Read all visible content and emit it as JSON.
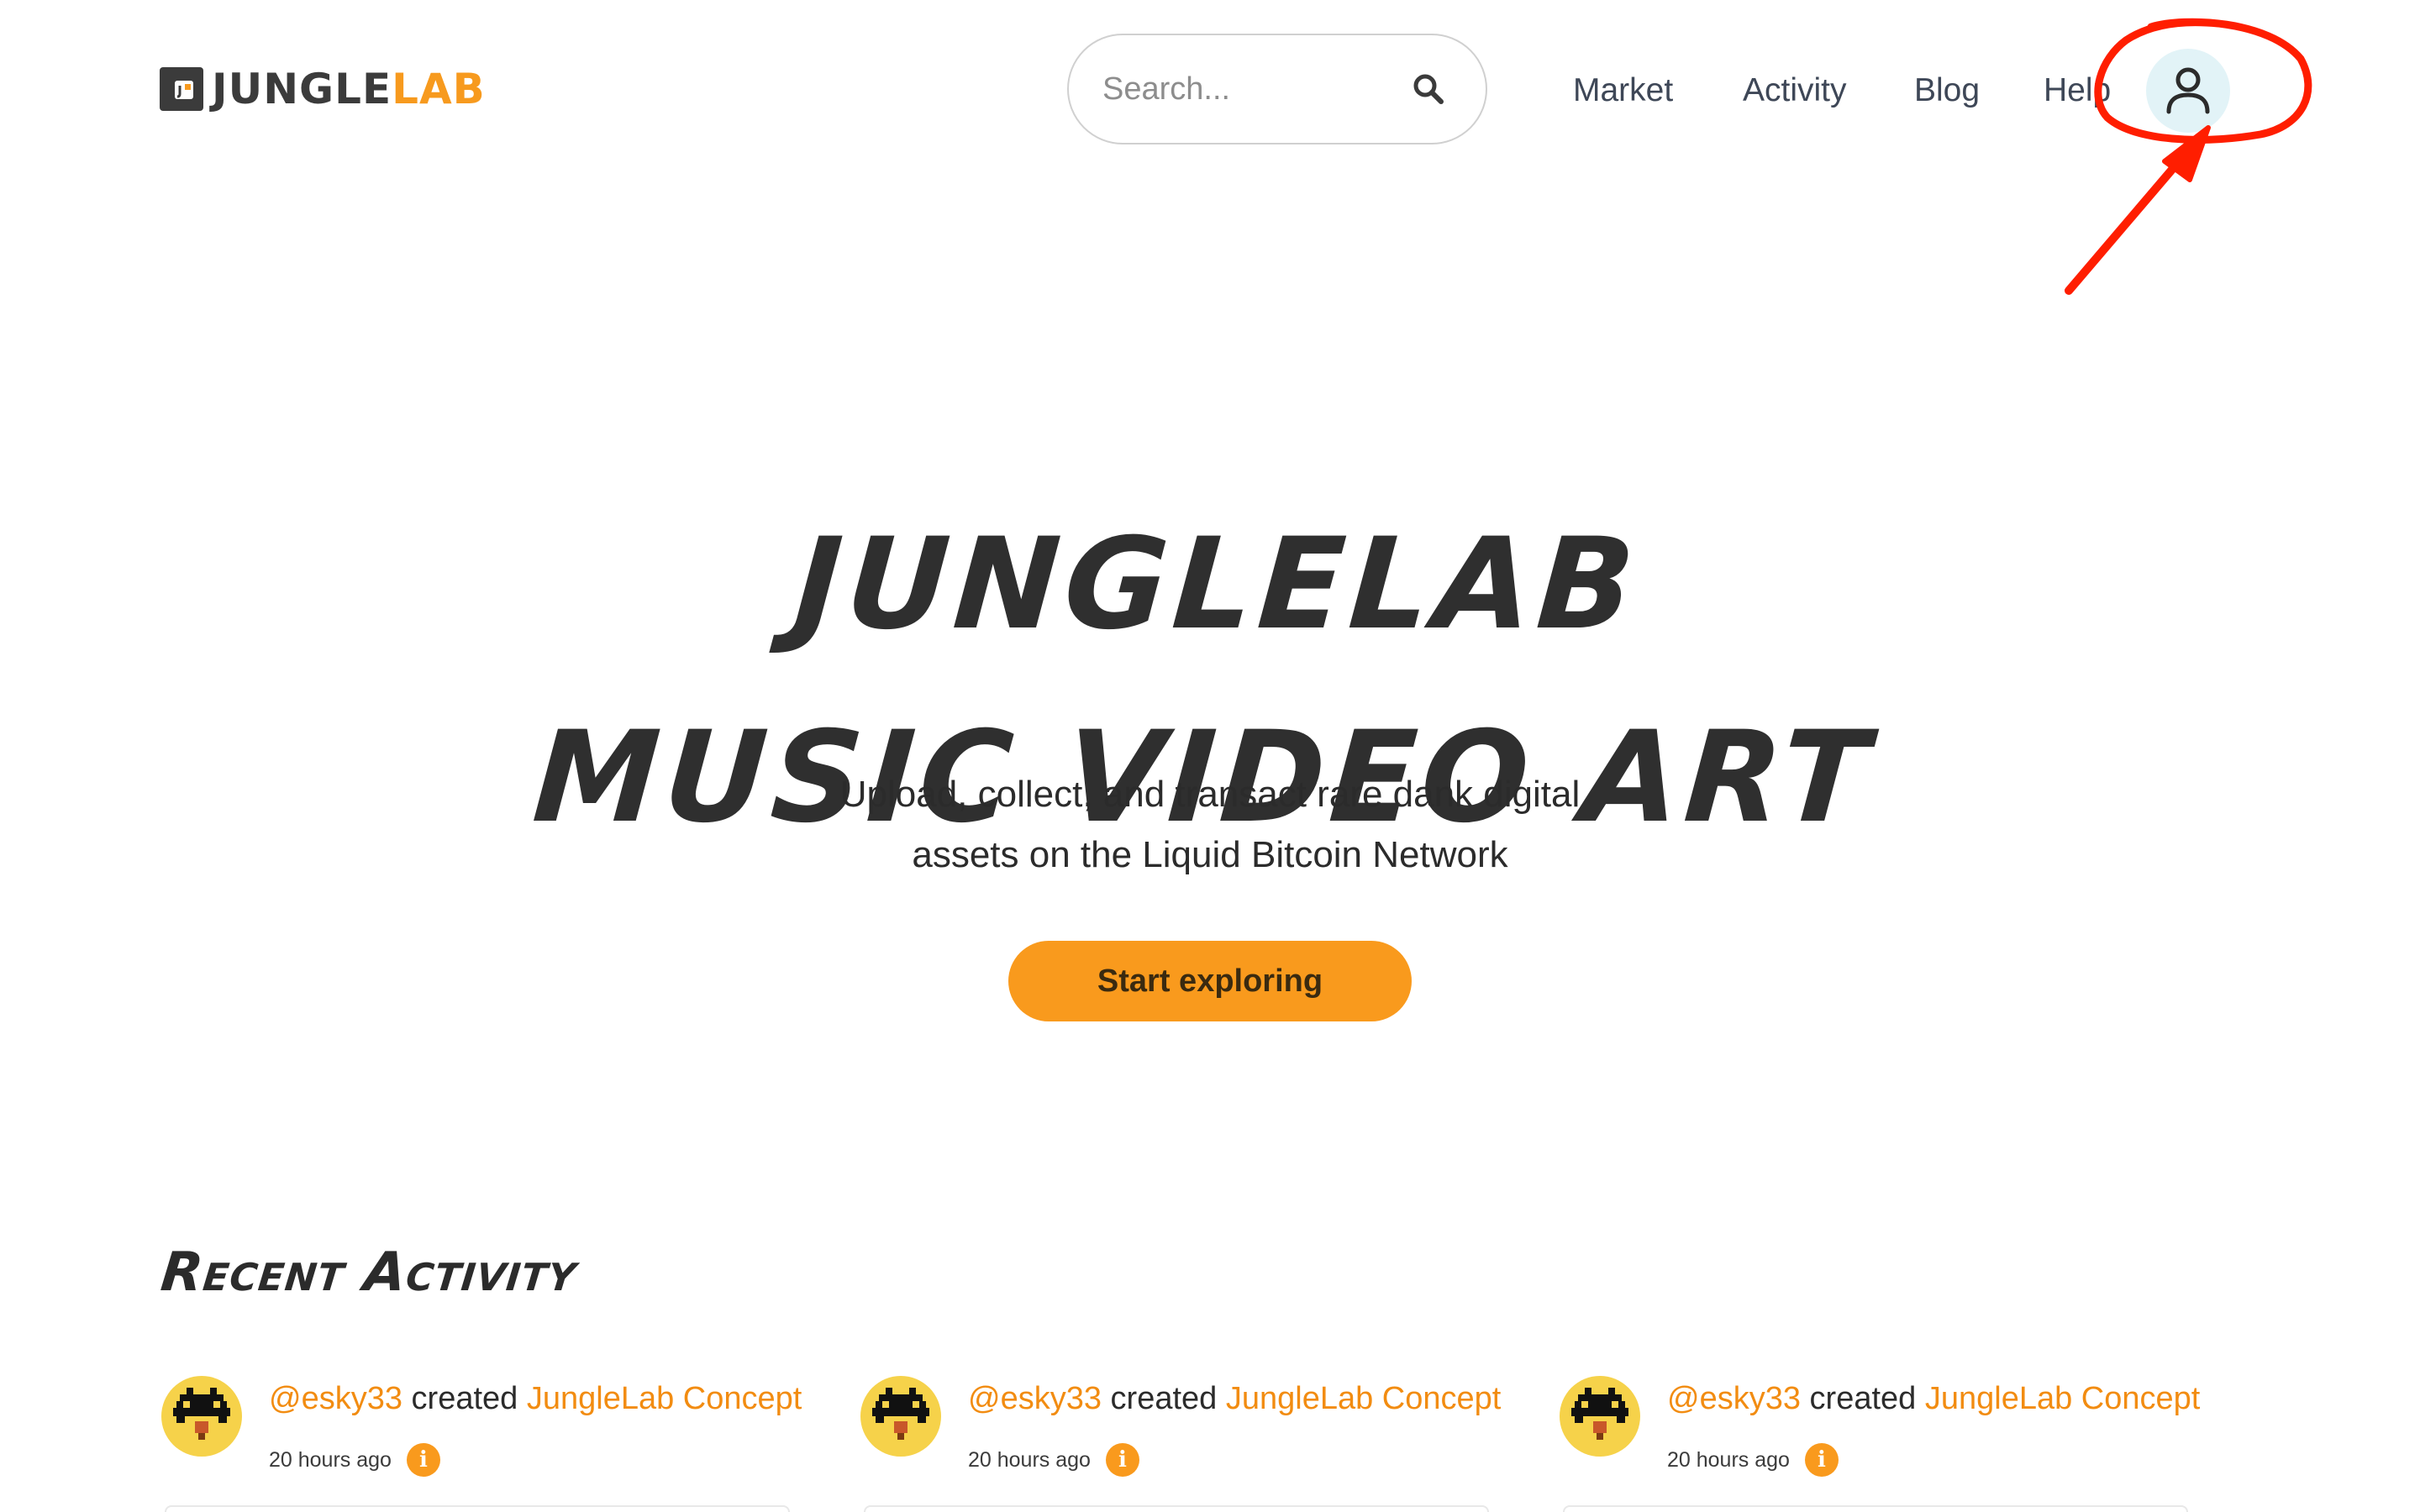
{
  "brand": {
    "name_part1": "JUNGLE",
    "name_part2": "LAB",
    "colors": {
      "accent": "#f79a1e",
      "dark": "#3b3b3b",
      "annotation": "#ff1e00"
    }
  },
  "search": {
    "placeholder": "Search...",
    "value": "",
    "icon": "search-icon"
  },
  "nav": {
    "items": [
      {
        "label": "Market"
      },
      {
        "label": "Activity"
      },
      {
        "label": "Blog"
      },
      {
        "label": "Help"
      }
    ],
    "account_icon": "user-icon"
  },
  "hero": {
    "title_line1": "JungleLab",
    "title_line2": "music video art",
    "subtitle_line1": "Upload, collect, and transact rare dank digital",
    "subtitle_line2": "assets on the Liquid Bitcoin Network",
    "cta_label": "Start exploring"
  },
  "recent_activity": {
    "title": "Recent Activity",
    "items": [
      {
        "user": "@esky33",
        "action": "created",
        "item": "JungleLab Concept",
        "time": "20 hours ago",
        "icon": "info-icon"
      },
      {
        "user": "@esky33",
        "action": "created",
        "item": "JungleLab Concept",
        "time": "20 hours ago",
        "icon": "info-icon"
      },
      {
        "user": "@esky33",
        "action": "created",
        "item": "JungleLab Concept",
        "time": "20 hours ago",
        "icon": "info-icon"
      }
    ]
  }
}
